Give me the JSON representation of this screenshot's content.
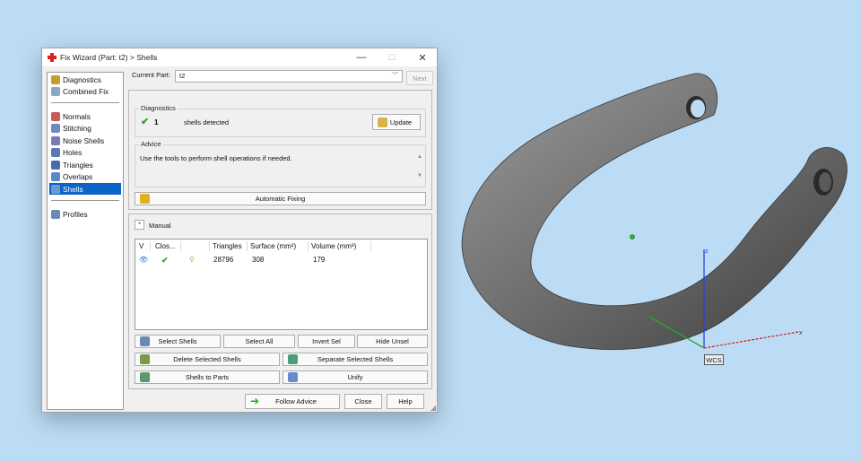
{
  "window": {
    "title": "Fix Wizard (Part: t2) > Shells",
    "minimize": "—",
    "maximize": "☐",
    "close": "✕"
  },
  "sidebar": {
    "items": [
      {
        "label": "Diagnostics",
        "icon": "magnifier-icon",
        "color": "#c89a2a"
      },
      {
        "label": "Combined Fix",
        "icon": "combined-fix-icon",
        "color": "#8aa6c8"
      },
      {
        "label": "Normals",
        "icon": "normals-icon",
        "color": "#c85a5a"
      },
      {
        "label": "Stitching",
        "icon": "stitching-icon",
        "color": "#6a8ac0"
      },
      {
        "label": "Noise Shells",
        "icon": "noise-shells-icon",
        "color": "#7a7ab0"
      },
      {
        "label": "Holes",
        "icon": "holes-icon",
        "color": "#5a7ab0"
      },
      {
        "label": "Triangles",
        "icon": "triangles-icon",
        "color": "#4a6ab0"
      },
      {
        "label": "Overlaps",
        "icon": "overlaps-icon",
        "color": "#5a8ac8"
      },
      {
        "label": "Shells",
        "icon": "shells-icon",
        "color": "#6a9ad8"
      },
      {
        "label": "Profiles",
        "icon": "profiles-icon",
        "color": "#6a8ab0"
      }
    ]
  },
  "current_part": {
    "label": "Current Part:",
    "value": "t2",
    "next_label": "Next"
  },
  "diagnostics": {
    "group_title": "Diagnostics",
    "count": "1",
    "text": "shells detected",
    "update_label": "Update"
  },
  "advice": {
    "group_title": "Advice",
    "text": "Use the tools to perform shell operations if needed."
  },
  "automatic_fixing_label": "Automatic Fixing",
  "manual": {
    "label": "Manual",
    "columns": [
      "V",
      "Clos...",
      "",
      "Triangles",
      "Surface (mm²)",
      "Volume (mm³)"
    ],
    "rows": [
      {
        "triangles": "28796",
        "surface": "308",
        "volume": "179"
      }
    ]
  },
  "actions": {
    "select_shells": "Select Shells",
    "select_all": "Select All",
    "invert_sel": "Invert Sel",
    "hide_unsel": "Hide Unsel",
    "delete_selected": "Delete Selected Shells",
    "separate_selected": "Separate Selected Shells",
    "shells_to_parts": "Shells to Parts",
    "unify": "Unify"
  },
  "footer": {
    "follow_advice": "Follow Advice",
    "close": "Close",
    "help": "Help"
  },
  "viewport": {
    "wcs_label": "WCS",
    "axis_x": "x",
    "axis_z": "z",
    "colors": {
      "background": "#bcdcf5",
      "x_axis": "#d02020",
      "y_axis": "#22aa22",
      "z_axis": "#2244dd",
      "model": "#6e6e6e"
    }
  }
}
